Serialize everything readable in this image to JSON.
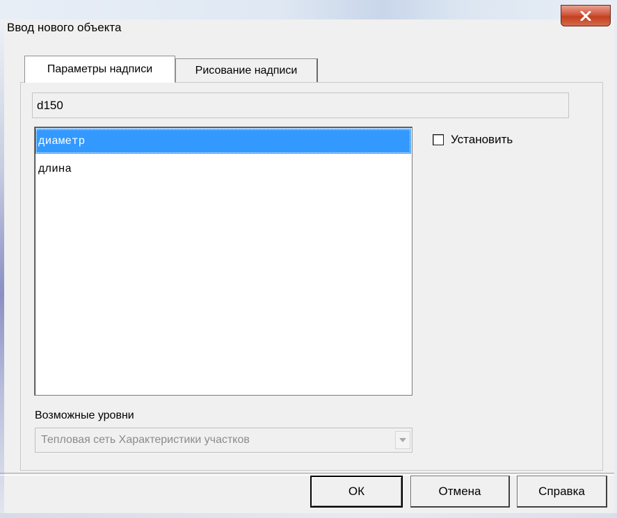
{
  "window": {
    "title": "Ввод нового объекта"
  },
  "tabs": [
    {
      "label": "Параметры надписи",
      "active": true
    },
    {
      "label": "Рисование надписи",
      "active": false
    }
  ],
  "text_field": {
    "value": "d150"
  },
  "list": {
    "items": [
      {
        "label": "диаметр",
        "selected": true
      },
      {
        "label": "длина",
        "selected": false
      }
    ]
  },
  "checkbox": {
    "label": "Установить",
    "checked": false
  },
  "levels": {
    "label": "Возможные уровни",
    "selected": "Тепловая сеть Характеристики участков"
  },
  "buttons": {
    "ok": "ОК",
    "cancel": "Отмена",
    "help": "Справка"
  },
  "colors": {
    "selection": "#3399ff",
    "close_button": "#c7442a"
  }
}
